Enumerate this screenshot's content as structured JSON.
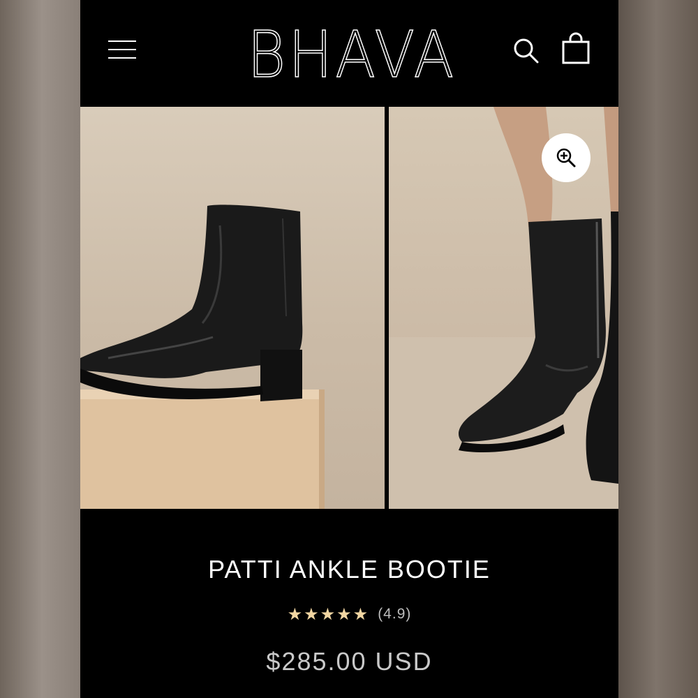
{
  "header": {
    "logo": "BHAVA",
    "icons": {
      "menu": "hamburger-menu-icon",
      "search": "search-icon",
      "cart": "shopping-bag-icon"
    }
  },
  "gallery": {
    "zoom_icon": "zoom-in-icon"
  },
  "product": {
    "title": "PATTI ANKLE BOOTIE",
    "rating_stars": 5,
    "rating_value": 4.9,
    "rating_label": "(4.9)",
    "price": "$285.00 USD"
  },
  "colors": {
    "header_bg": "#000000",
    "text": "#ffffff",
    "star": "#f2d6a2",
    "price": "#c9c9c9"
  }
}
